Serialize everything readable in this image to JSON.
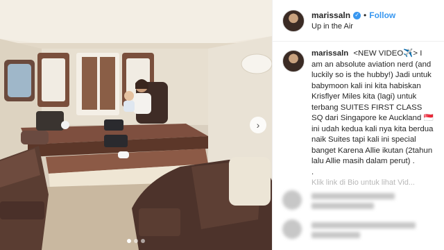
{
  "post": {
    "username": "marissaln",
    "verified_icon": "verified-badge-icon",
    "follow_label": "Follow",
    "separator": "•",
    "location": "Up in the Air"
  },
  "caption": {
    "username": "marissaln",
    "text": "<NEW VIDEO✈️> I am an absolute aviation nerd (and luckily so is the hubby!) Jadi untuk babymoon kali ini kita habiskan Krisflyer Miles kita (lagi) untuk terbang SUITES FIRST CLASS SQ dari Singapore ke Auckland 🇸🇬 ini udah kedua kali nya kita berdua naik Suites tapi kali ini special banget Karena Allie ikutan (2tahun lalu Allie masih dalam perut) .",
    "line_break": ".",
    "clipped_line": "Klik link di Bio untuk lihat Vid..."
  },
  "photo": {
    "carousel_count": 3,
    "carousel_active": 1,
    "next_arrow": "›"
  },
  "colors": {
    "accent": "#3897f0",
    "seat_leather": "#5a3d32",
    "cabin_wall": "#ece5d6"
  }
}
